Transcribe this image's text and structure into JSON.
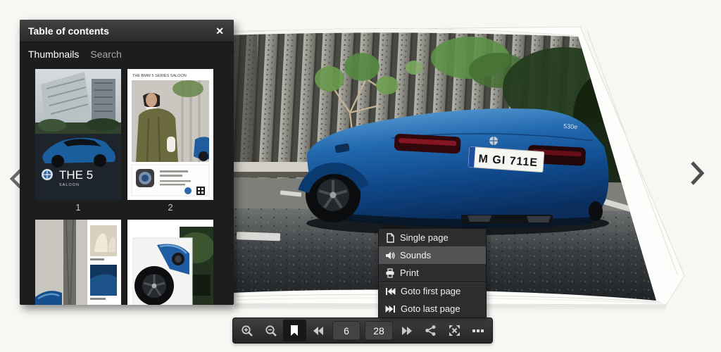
{
  "colors": {
    "background": "#f7f7f4",
    "panel_bg": "#1d1d1d",
    "toolbar_bg": "#2f2f2f",
    "menu_bg": "#2d2d2d",
    "menu_active_bg": "#545454",
    "car_blue": "#1f63ae"
  },
  "toc_panel": {
    "title": "Table of contents",
    "close_label": "✕",
    "tabs": [
      {
        "label": "Thumbnails",
        "active": true
      },
      {
        "label": "Search",
        "active": false
      }
    ],
    "thumbnails": [
      {
        "page_label": "1",
        "cover_title": "THE 5",
        "cover_subtitle": "SALOON"
      },
      {
        "page_label": "2",
        "header_text": "THE BMW 5 SERIES SALOON"
      },
      {
        "page_label": ""
      },
      {
        "page_label": ""
      }
    ]
  },
  "book": {
    "license_plate": "M GI 711E",
    "model_badge": "530e"
  },
  "context_menu": {
    "items": [
      {
        "label": "Single page",
        "icon": "single-page-icon",
        "active": false
      },
      {
        "label": "Sounds",
        "icon": "sound-icon",
        "active": true
      },
      {
        "label": "Print",
        "icon": "print-icon",
        "active": false
      },
      {
        "label": "Goto first page",
        "icon": "goto-first-icon",
        "active": false
      },
      {
        "label": "Goto last page",
        "icon": "goto-last-icon",
        "active": false
      }
    ]
  },
  "toolbar": {
    "page_current": "6",
    "page_total": "28",
    "buttons": [
      "zoom-in",
      "zoom-out",
      "bookmark",
      "previous-page",
      "next-page",
      "share",
      "fullscreen",
      "more"
    ]
  }
}
